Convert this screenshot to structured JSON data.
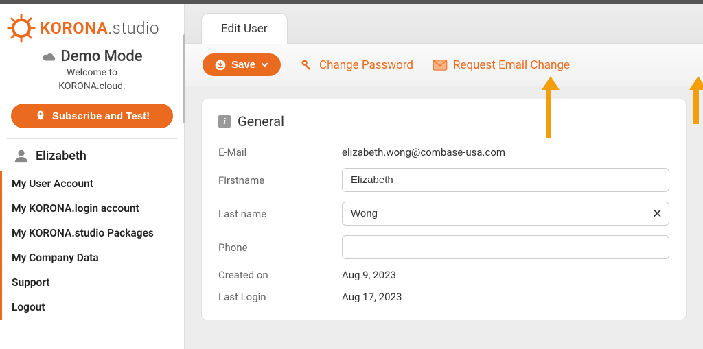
{
  "brand": {
    "name": "KORONA",
    "suffix": ".studio"
  },
  "sidebar": {
    "demo_title": "Demo Mode",
    "demo_sub_line1": "Welcome to",
    "demo_sub_line2": "KORONA.cloud.",
    "subscribe_label": "Subscribe and Test!",
    "user_name": "Elizabeth",
    "items": [
      {
        "label": "My User Account"
      },
      {
        "label": "My KORONA.login account"
      },
      {
        "label": "My KORONA.studio Packages"
      },
      {
        "label": "My Company Data"
      },
      {
        "label": "Support"
      },
      {
        "label": "Logout"
      }
    ]
  },
  "tab": {
    "label": "Edit User"
  },
  "toolbar": {
    "save_label": "Save",
    "change_password_label": "Change Password",
    "request_email_label": "Request Email Change"
  },
  "section": {
    "title": "General",
    "fields": {
      "email_label": "E-Mail",
      "email_value": "elizabeth.wong@combase-usa.com",
      "firstname_label": "Firstname",
      "firstname_value": "Elizabeth",
      "lastname_label": "Last name",
      "lastname_value": "Wong",
      "phone_label": "Phone",
      "phone_value": "",
      "created_label": "Created on",
      "created_value": "Aug 9, 2023",
      "lastlogin_label": "Last Login",
      "lastlogin_value": "Aug 17, 2023"
    }
  },
  "colors": {
    "accent": "#ea6b1f"
  }
}
